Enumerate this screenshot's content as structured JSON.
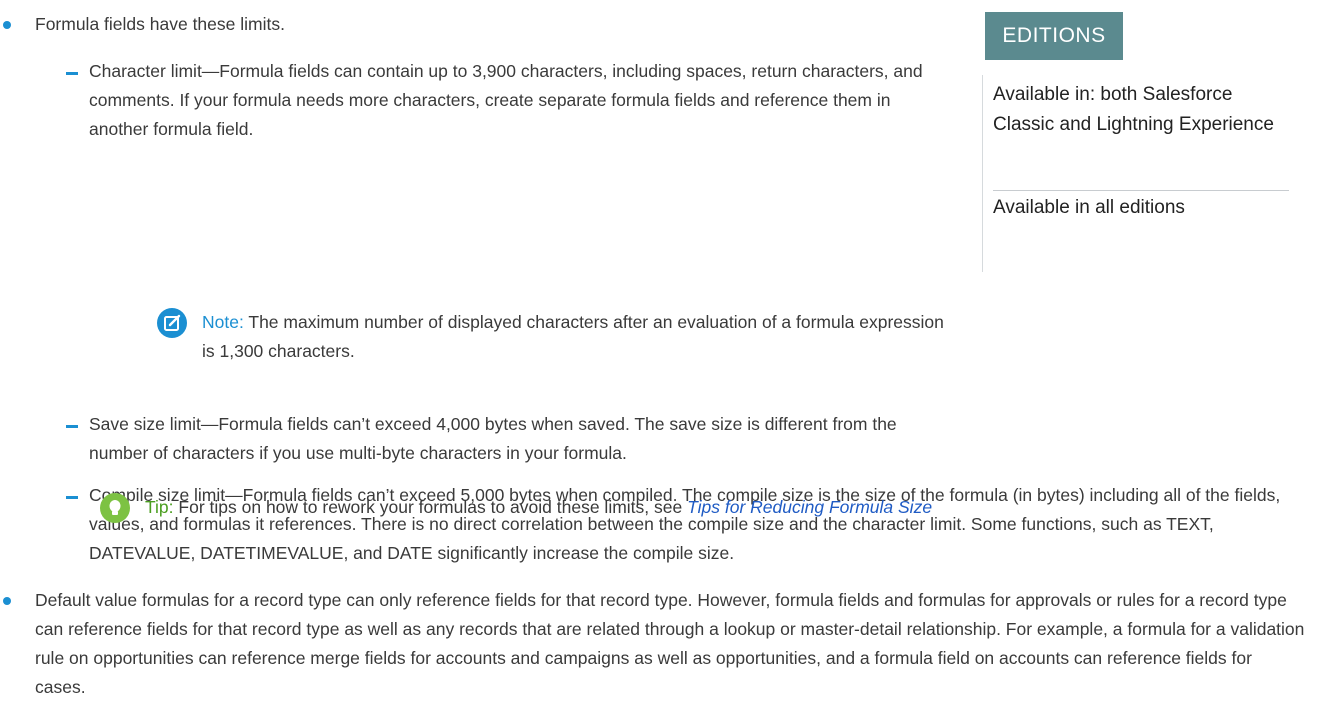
{
  "content": {
    "intro": "Formula fields have these limits.",
    "char_limit": "Character limit—Formula fields can contain up to 3,900 characters, including spaces, return characters, and comments. If your formula needs more characters, create separate formula fields and reference them in another formula field.",
    "note_label": "Note:",
    "note_text": "The maximum number of displayed characters after an evaluation of a formula expression is 1,300 characters.",
    "save_limit": "Save size limit—Formula fields can’t exceed 4,000 bytes when saved. The save size is different from the number of characters if you use multi-byte characters in your formula.",
    "compile_limit": "Compile size limit—Formula fields can’t exceed 5,000 bytes when compiled. The compile size is the size of the formula (in bytes) including all of the fields, values, and formulas it references. There is no direct correlation between the compile size and the character limit. Some functions, such as TEXT, DATEVALUE, DATETIMEVALUE, and DATE significantly increase the compile size.",
    "tip_label": "Tip:",
    "tip_text": "For tips on how to rework your formulas to avoid these limits, see",
    "tip_link": "Tips for Reducing Formula Size",
    "default_value": "Default value formulas for a record type can only reference fields for that record type. However, formula fields and formulas for approvals or rules for a record type can reference fields for that record type as well as any records that are related through a lookup or master-detail relationship. For example, a formula for a validation rule on opportunities can reference merge fields for accounts and campaigns as well as opportunities, and a formula field on accounts can reference fields for cases."
  },
  "sidebar": {
    "editions_label": "EDITIONS",
    "availability": "Available in: both Salesforce Classic and Lightning Experience",
    "editions": "Available in all editions"
  },
  "icons": {
    "bullet": "bullet-dot-icon",
    "dash": "dash-icon",
    "note": "note-pencil-icon",
    "tip": "lightbulb-icon"
  },
  "colors": {
    "accent_blue": "#1b8fd2",
    "tip_green": "#7dc243",
    "editions_bg": "#5b8a8f"
  }
}
